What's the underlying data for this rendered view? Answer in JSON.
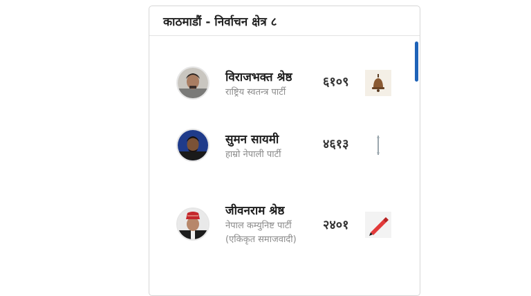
{
  "card": {
    "title": "काठमाडौं - निर्वाचन क्षेत्र ८"
  },
  "candidates": [
    {
      "name": "विराजभक्त श्रेष्ठ",
      "party": "राष्ट्रिय स्वतन्त्र पार्टी",
      "votes": "६१०९",
      "symbol": "bell-icon",
      "avatar": "candidate-photo"
    },
    {
      "name": "सुमन सायमी",
      "party": "हाम्रो नेपाली पार्टी",
      "votes": "४६१३",
      "symbol": "stick-icon",
      "avatar": "candidate-photo"
    },
    {
      "name": "जीवनराम श्रेष्ठ",
      "party_line1": "नेपाल कम्युनिष्ट पार्टी",
      "party_line2": "(एकिकृत समाजवादी)",
      "votes": "२४०१",
      "symbol": "pen-icon",
      "avatar": "candidate-photo"
    }
  ],
  "colors": {
    "scroll_thumb": "#1e63b8",
    "pen": "#e23a3a"
  }
}
